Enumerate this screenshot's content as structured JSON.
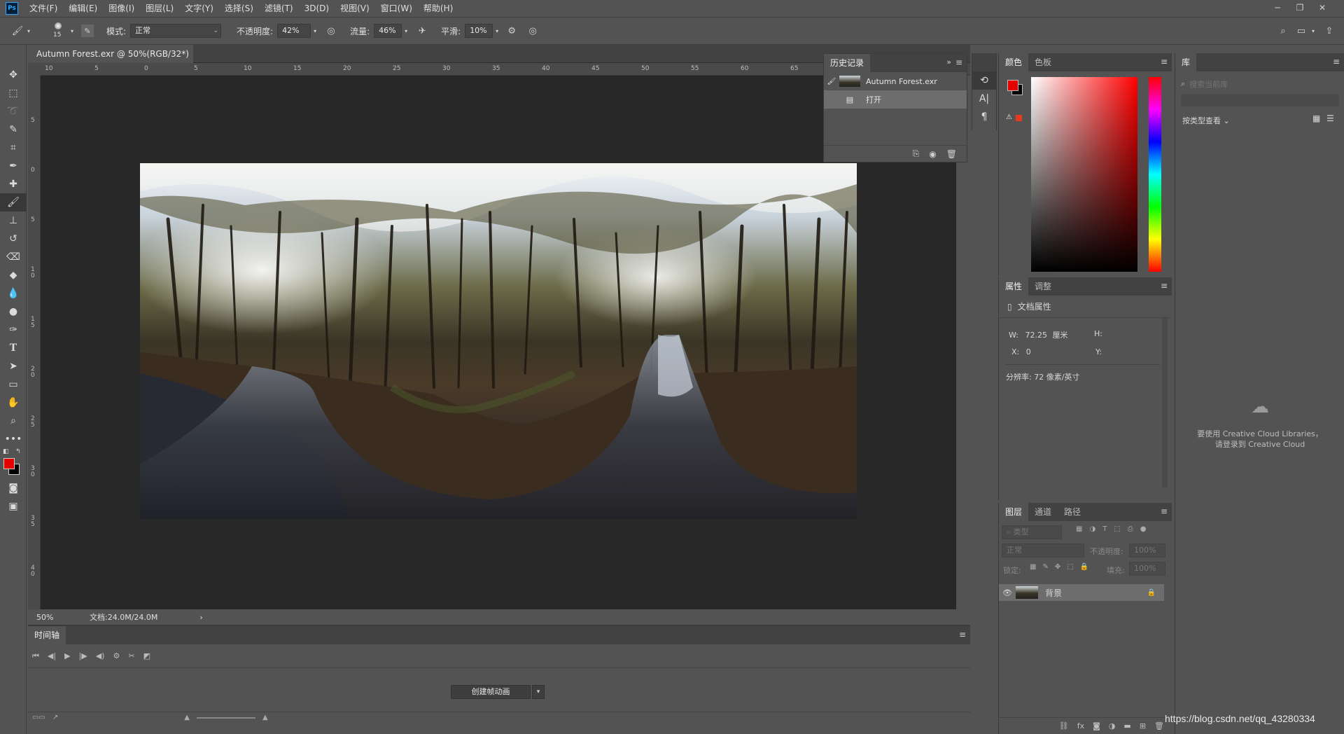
{
  "app": {
    "logo": "Ps"
  },
  "menu": [
    "文件(F)",
    "编辑(E)",
    "图像(I)",
    "图层(L)",
    "文字(Y)",
    "选择(S)",
    "滤镜(T)",
    "3D(D)",
    "视图(V)",
    "窗口(W)",
    "帮助(H)"
  ],
  "options": {
    "brush_size": "15",
    "mode_label": "模式:",
    "mode_value": "正常",
    "opacity_label": "不透明度:",
    "opacity_value": "42%",
    "flow_label": "流量:",
    "flow_value": "46%",
    "smooth_label": "平滑:",
    "smooth_value": "10%"
  },
  "document": {
    "tab_title": "Autumn Forest.exr @ 50%(RGB/32*) *",
    "zoom": "50%",
    "doc_info": "文档:24.0M/24.0M"
  },
  "rulers": {
    "h": [
      "10",
      "5",
      "0",
      "5",
      "10",
      "15",
      "20",
      "25",
      "30",
      "35",
      "40",
      "45",
      "50",
      "55",
      "60",
      "65"
    ],
    "v": [
      "5",
      "0",
      "5",
      "1 0",
      "1 5",
      "2 0",
      "2 5",
      "3 0",
      "3 5",
      "4 0"
    ]
  },
  "history": {
    "tab": "历史记录",
    "items": [
      {
        "label": "Autumn Forest.exr",
        "type": "snapshot"
      },
      {
        "label": "打开",
        "type": "step"
      }
    ]
  },
  "color_panel": {
    "tabs": [
      "颜色",
      "色板"
    ],
    "fg_color": "#e50000",
    "bg_color": "#000000"
  },
  "properties": {
    "tabs": [
      "属性",
      "调整"
    ],
    "doc_label": "文档属性",
    "w_label": "W:",
    "w_value": "72.25",
    "w_unit": "厘米",
    "h_label": "H:",
    "x_label": "X:",
    "x_value": "0",
    "y_label": "Y:",
    "resolution": "分辨率: 72 像素/英寸"
  },
  "layers": {
    "tabs": [
      "图层",
      "通道",
      "路径"
    ],
    "filter_placeholder": "类型",
    "blend_mode": "正常",
    "opacity_label": "不透明度:",
    "opacity_value": "100%",
    "lock_label": "锁定:",
    "fill_label": "填充:",
    "fill_value": "100%",
    "items": [
      {
        "name": "背景",
        "visible": true,
        "locked": true
      }
    ]
  },
  "library": {
    "tab": "库",
    "search_placeholder": "搜索当前库",
    "view_by": "按类型查看",
    "message_line1": "要使用 Creative Cloud Libraries，",
    "message_line2": "请登录到 Creative Cloud"
  },
  "timeline": {
    "tab": "时间轴",
    "create_button": "创建帧动画"
  },
  "watermark": "https://blog.csdn.net/qq_43280334"
}
